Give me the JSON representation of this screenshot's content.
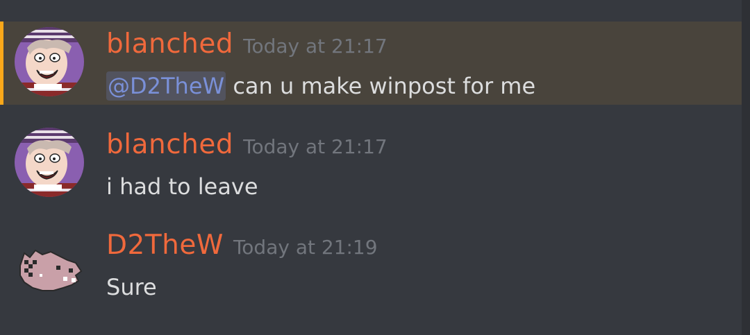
{
  "colors": {
    "background": "#36393f",
    "highlight_background": "#49443c",
    "highlight_bar": "#faa81a",
    "author": "#f0693c",
    "timestamp": "#72767d",
    "text": "#dcddde",
    "mention": "#7a90d8"
  },
  "messages": [
    {
      "author": "blanched",
      "timestamp": "Today at 21:17",
      "mention": "@D2TheW",
      "text": " can u make winpost for me",
      "highlighted": true,
      "avatar_icon": "cartoon-face-avatar"
    },
    {
      "author": "blanched",
      "timestamp": "Today at 21:17",
      "text": "i had to leave",
      "highlighted": false,
      "avatar_icon": "cartoon-face-avatar"
    },
    {
      "author": "D2TheW",
      "timestamp": "Today at 21:19",
      "text": "Sure",
      "highlighted": false,
      "avatar_icon": "pixel-creature-avatar"
    }
  ]
}
